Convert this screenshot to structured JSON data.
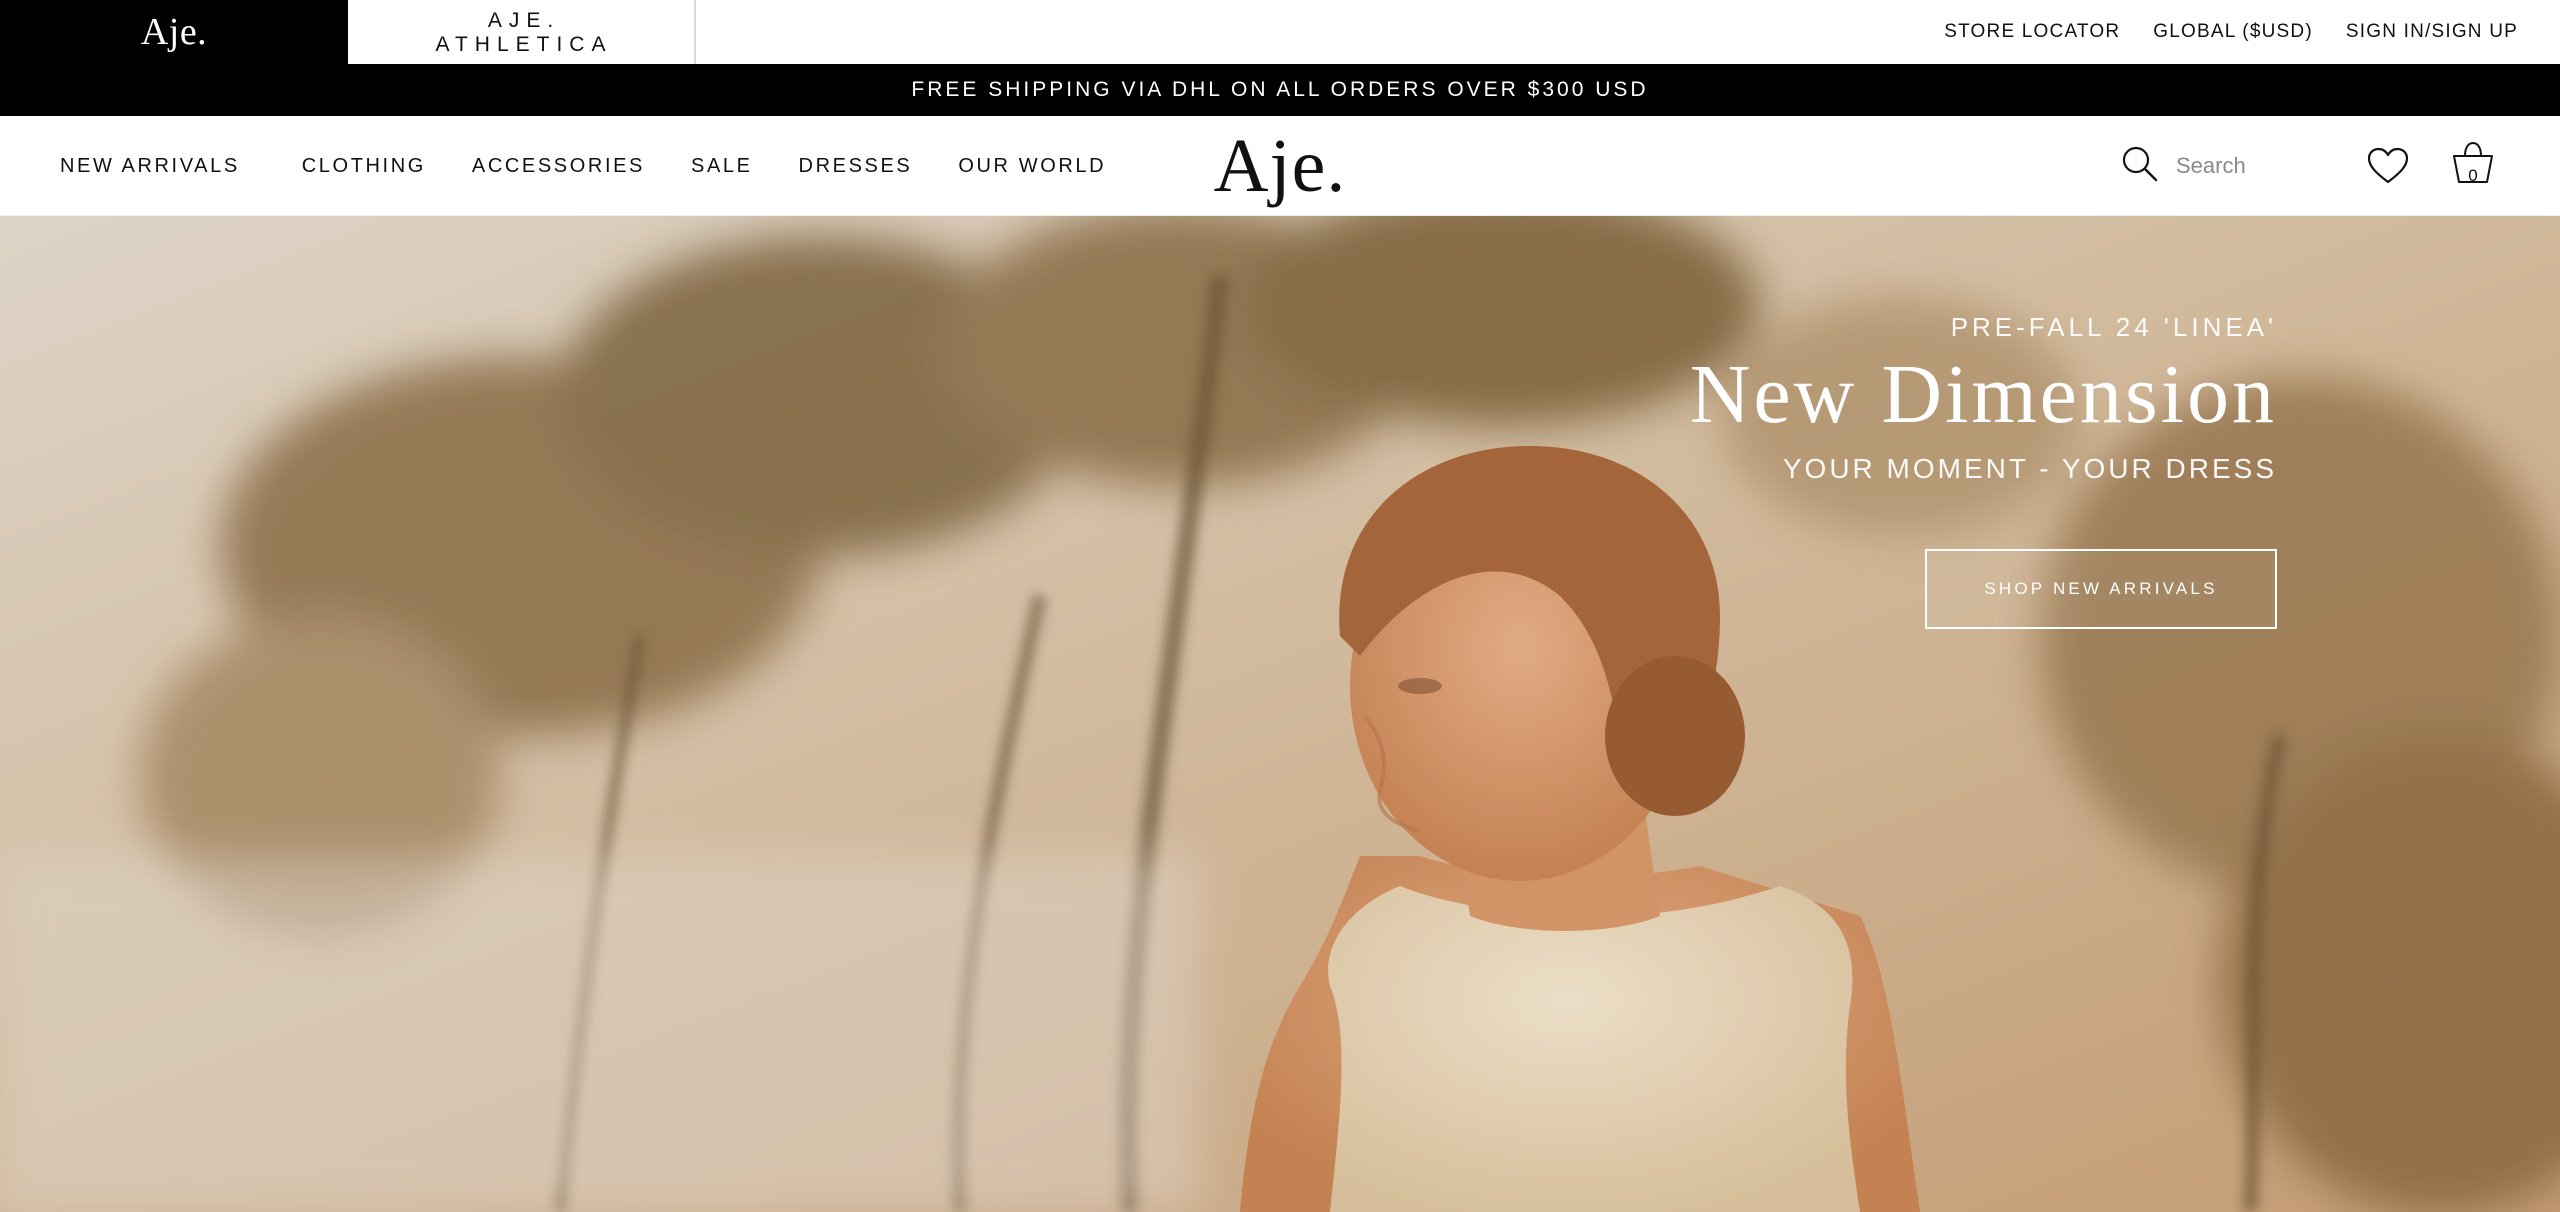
{
  "topbar": {
    "brand_main": "Aje.",
    "brand_athletica_line1": "AJE.",
    "brand_athletica_line2": "ATHLETICA",
    "links": [
      "STORE LOCATOR",
      "GLOBAL ($USD)",
      "SIGN IN/SIGN UP"
    ]
  },
  "announcement": "FREE SHIPPING VIA DHL ON ALL ORDERS OVER $300 USD",
  "nav": {
    "items": [
      "NEW ARRIVALS",
      "CLOTHING",
      "ACCESSORIES",
      "SALE",
      "DRESSES",
      "OUR WORLD"
    ],
    "logo": "Aje.",
    "search_placeholder": "Search",
    "bag_count": "0"
  },
  "hero": {
    "eyebrow": "PRE-FALL 24 'LINEA'",
    "title": "New Dimension",
    "subtitle": "YOUR MOMENT - YOUR DRESS",
    "cta": "SHOP NEW ARRIVALS"
  },
  "colors": {
    "black": "#000000",
    "white": "#ffffff",
    "hero_warm": "#c9a47c"
  },
  "icons": [
    "search-icon",
    "heart-icon",
    "shopping-bag-icon"
  ]
}
